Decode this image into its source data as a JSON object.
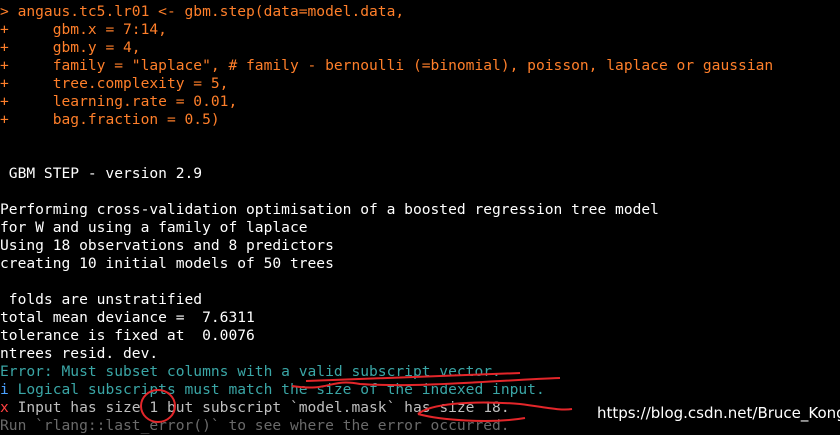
{
  "console": {
    "partial_top": "",
    "lines": [
      {
        "prefix": "> ",
        "text": "angaus.tc5.lr01 <- gbm.step(data=model.data,",
        "kind": "cmd"
      },
      {
        "prefix": "+ ",
        "text": "    gbm.x = 7:14,",
        "kind": "cmd"
      },
      {
        "prefix": "+ ",
        "text": "    gbm.y = 4,",
        "kind": "cmd"
      },
      {
        "prefix": "+ ",
        "text": "    family = \"laplace\", # family - bernoulli (=binomial), poisson, laplace or gaussian",
        "kind": "cmd"
      },
      {
        "prefix": "+ ",
        "text": "    tree.complexity = 5,",
        "kind": "cmd"
      },
      {
        "prefix": "+ ",
        "text": "    learning.rate = 0.01,",
        "kind": "cmd"
      },
      {
        "prefix": "+ ",
        "text": "    bag.fraction = 0.5)",
        "kind": "cmd"
      },
      {
        "prefix": "",
        "text": "",
        "kind": "out"
      },
      {
        "prefix": "",
        "text": "",
        "kind": "out"
      },
      {
        "prefix": "",
        "text": " GBM STEP - version 2.9",
        "kind": "out"
      },
      {
        "prefix": "",
        "text": "",
        "kind": "out"
      },
      {
        "prefix": "",
        "text": "Performing cross-validation optimisation of a boosted regression tree model",
        "kind": "out"
      },
      {
        "prefix": "",
        "text": "for W and using a family of laplace",
        "kind": "out"
      },
      {
        "prefix": "",
        "text": "Using 18 observations and 8 predictors",
        "kind": "out"
      },
      {
        "prefix": "",
        "text": "creating 10 initial models of 50 trees",
        "kind": "out"
      },
      {
        "prefix": "",
        "text": "",
        "kind": "out"
      },
      {
        "prefix": "",
        "text": " folds are unstratified",
        "kind": "out"
      },
      {
        "prefix": "",
        "text": "total mean deviance =  7.6311",
        "kind": "out"
      },
      {
        "prefix": "",
        "text": "tolerance is fixed at  0.0076",
        "kind": "out"
      },
      {
        "prefix": "",
        "text": "ntrees resid. dev.",
        "kind": "out"
      },
      {
        "prefix": "",
        "text": "Error: Must subset columns with a valid subscript vector.",
        "kind": "err"
      },
      {
        "prefix": "i ",
        "text": "Logical subscripts must match the size of the indexed input.",
        "kind": "err"
      },
      {
        "prefix": "x ",
        "text": "Input has size 1 but subscript `model.mask` has size 18.",
        "kind": "cross"
      },
      {
        "prefix": "",
        "text": "Run `rlang::last_error()` to see where the error occurred.",
        "kind": "faint"
      }
    ]
  },
  "watermark": "https://blog.csdn.net/Bruce_Kong",
  "colors": {
    "background": "#000000",
    "command": "#ff7f2a",
    "output": "#ffffff",
    "error": "#3aa6a6",
    "info_icon": "#4aa0ff",
    "cross_icon": "#ff4040",
    "annotation": "#e3262a"
  }
}
